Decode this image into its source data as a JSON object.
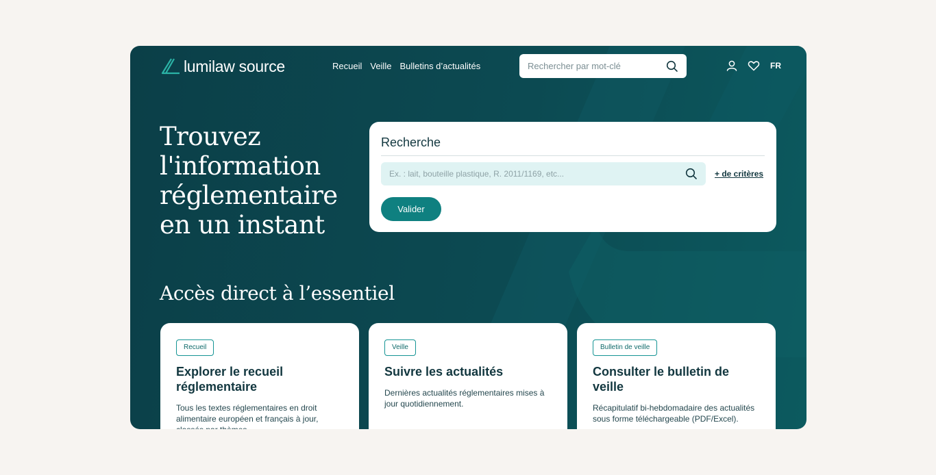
{
  "header": {
    "logo_text": "lumilaw source",
    "nav": [
      "Recueil",
      "Veille",
      "Bulletins d’actualités"
    ],
    "search_placeholder": "Rechercher par mot-clé",
    "lang": "FR",
    "icons": [
      "search-icon",
      "user-icon",
      "heart-icon"
    ]
  },
  "hero": {
    "title": "Trouvez l'information réglementaire en un instant"
  },
  "search_card": {
    "title": "Recherche",
    "placeholder": "Ex. : lait, bouteille plastique, R. 2011/1169, etc...",
    "criteria_link": "+ de critères",
    "submit_label": "Valider"
  },
  "section": {
    "title": "Accès direct à l’essentiel"
  },
  "cards": [
    {
      "badge": "Recueil",
      "title": "Explorer le recueil réglementaire",
      "desc": "Tous les textes réglementaires en droit alimentaire européen et français à jour, classés par thèmes."
    },
    {
      "badge": "Veille",
      "title": "Suivre les actualités",
      "desc": "Dernières actualités réglementaires mises à jour quotidiennement."
    },
    {
      "badge": "Bulletin de veille",
      "title": "Consulter le bulletin de veille",
      "desc": "Récapitulatif bi-hebdomadaire des actualités sous forme téléchargeable (PDF/Excel)."
    }
  ],
  "colors": {
    "page_bg": "#f7f4f1",
    "hero_bg": "#0c4a52",
    "accent": "#0f8080",
    "search_field_bg": "#dff3f3",
    "text_dark": "#12373f"
  }
}
